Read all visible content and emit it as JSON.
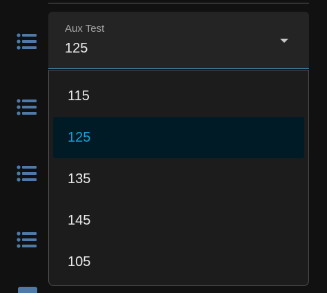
{
  "field": {
    "label": "Aux Test",
    "value": "125"
  },
  "menu": {
    "options": [
      "115",
      "125",
      "135",
      "145",
      "105"
    ],
    "selected_index": 1
  },
  "colors": {
    "accent": "#0ea5d8",
    "icon": "#4f7aa8",
    "selected_bg": "#001a26"
  },
  "icons": {
    "row": "list-icon",
    "below": "device-icon"
  }
}
